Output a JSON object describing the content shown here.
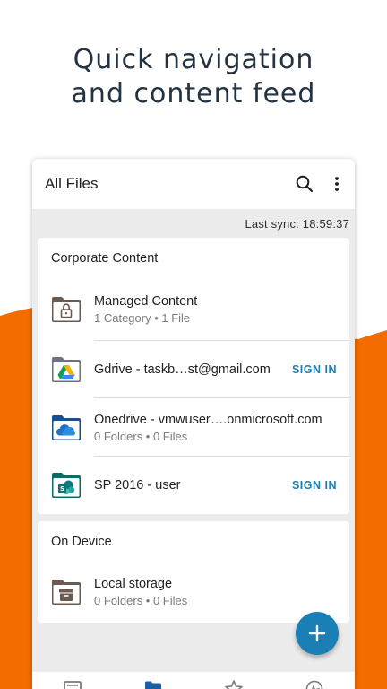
{
  "headline": {
    "line1": "Quick navigation",
    "line2": "and content feed"
  },
  "colors": {
    "accent_orange": "#F26C00",
    "accent_blue": "#1A7FB5",
    "headline_text": "#243342",
    "background": "#ECECEC"
  },
  "app_bar": {
    "title": "All Files",
    "search_icon": "search-icon",
    "more_icon": "more-vert-icon"
  },
  "last_sync": "Last sync: 18:59:37",
  "sections": [
    {
      "title": "Corporate Content",
      "items": [
        {
          "name": "Managed Content",
          "subtitle": "1 Category • 1 File",
          "icon": "managed-folder-lock-icon"
        },
        {
          "name": "Gdrive - taskb…st@gmail.com",
          "action": "SIGN IN",
          "icon": "gdrive-folder-icon"
        },
        {
          "name": "Onedrive - vmwuser….onmicrosoft.com",
          "subtitle": "0 Folders • 0 Files",
          "icon": "onedrive-folder-icon"
        },
        {
          "name": "SP 2016 - user",
          "action": "SIGN IN",
          "icon": "sharepoint-folder-icon"
        }
      ]
    },
    {
      "title": "On Device",
      "items": [
        {
          "name": "Local storage",
          "subtitle": "0 Folders • 0 Files",
          "icon": "local-storage-folder-icon"
        }
      ]
    }
  ],
  "fab_icon": "plus-icon",
  "bottom_nav": [
    "feed-icon",
    "folder-icon",
    "star-icon",
    "activity-icon"
  ]
}
